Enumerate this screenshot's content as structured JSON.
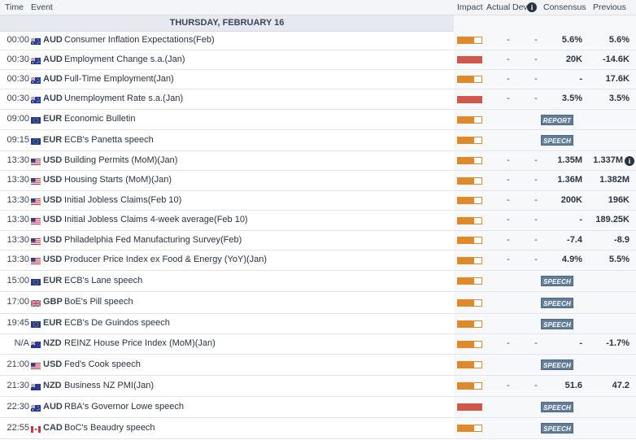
{
  "header": {
    "time": "Time",
    "event": "Event",
    "impact": "Impact",
    "actual": "Actual",
    "dev": "Dev",
    "consensus": "Consensus",
    "previous": "Previous"
  },
  "date_label": "THURSDAY, FEBRUARY 16",
  "colors": {
    "impact_medium": "#e0892a",
    "impact_high": "#d0574a",
    "tag_bg": "#627d98"
  },
  "rows": [
    {
      "time": "00:00",
      "flag": "au",
      "currency": "AUD",
      "event": "Consumer Inflation Expectations(Feb)",
      "impact": "medium",
      "actual": "-",
      "dev": "-",
      "consensus": "5.6%",
      "previous": "5.6%"
    },
    {
      "time": "00:30",
      "flag": "au",
      "currency": "AUD",
      "event": "Employment Change s.a.(Jan)",
      "impact": "high",
      "actual": "-",
      "dev": "-",
      "consensus": "20K",
      "previous": "-14.6K"
    },
    {
      "time": "00:30",
      "flag": "au",
      "currency": "AUD",
      "event": "Full-Time Employment(Jan)",
      "impact": "medium",
      "actual": "-",
      "dev": "-",
      "consensus": "-",
      "previous": "17.6K"
    },
    {
      "time": "00:30",
      "flag": "au",
      "currency": "AUD",
      "event": "Unemployment Rate s.a.(Jan)",
      "impact": "high",
      "actual": "-",
      "dev": "-",
      "consensus": "3.5%",
      "previous": "3.5%"
    },
    {
      "time": "09:00",
      "flag": "eu",
      "currency": "EUR",
      "event": "Economic Bulletin",
      "impact": "medium",
      "tag": "REPORT"
    },
    {
      "time": "09:15",
      "flag": "eu",
      "currency": "EUR",
      "event": "ECB's Panetta speech",
      "impact": "medium",
      "tag": "SPEECH"
    },
    {
      "time": "13:30",
      "flag": "us",
      "currency": "USD",
      "event": "Building Permits (MoM)(Jan)",
      "impact": "medium",
      "actual": "-",
      "dev": "-",
      "consensus": "1.35M",
      "previous": "1.337M",
      "prev_info": "i"
    },
    {
      "time": "13:30",
      "flag": "us",
      "currency": "USD",
      "event": "Housing Starts (MoM)(Jan)",
      "impact": "medium",
      "actual": "-",
      "dev": "-",
      "consensus": "1.36M",
      "previous": "1.382M"
    },
    {
      "time": "13:30",
      "flag": "us",
      "currency": "USD",
      "event": "Initial Jobless Claims(Feb 10)",
      "impact": "medium",
      "actual": "-",
      "dev": "-",
      "consensus": "200K",
      "previous": "196K"
    },
    {
      "time": "13:30",
      "flag": "us",
      "currency": "USD",
      "event": "Initial Jobless Claims 4-week average(Feb 10)",
      "impact": "medium",
      "actual": "-",
      "dev": "-",
      "consensus": "-",
      "previous": "189.25K"
    },
    {
      "time": "13:30",
      "flag": "us",
      "currency": "USD",
      "event": "Philadelphia Fed Manufacturing Survey(Feb)",
      "impact": "medium",
      "actual": "-",
      "dev": "-",
      "consensus": "-7.4",
      "previous": "-8.9"
    },
    {
      "time": "13:30",
      "flag": "us",
      "currency": "USD",
      "event": "Producer Price Index ex Food & Energy (YoY)(Jan)",
      "impact": "medium",
      "actual": "-",
      "dev": "-",
      "consensus": "4.9%",
      "previous": "5.5%"
    },
    {
      "time": "15:00",
      "flag": "eu",
      "currency": "EUR",
      "event": "ECB's Lane speech",
      "impact": "medium",
      "tag": "SPEECH"
    },
    {
      "time": "17:00",
      "flag": "gb",
      "currency": "GBP",
      "event": "BoE's Pill speech",
      "impact": "medium",
      "tag": "SPEECH"
    },
    {
      "time": "19:45",
      "flag": "eu",
      "currency": "EUR",
      "event": "ECB's De Guindos speech",
      "impact": "medium",
      "tag": "SPEECH"
    },
    {
      "time": "N/A",
      "flag": "nz",
      "currency": "NZD",
      "event": "REINZ House Price Index (MoM)(Jan)",
      "impact": "medium",
      "actual": "-",
      "dev": "-",
      "consensus": "-",
      "previous": "-1.7%"
    },
    {
      "time": "21:00",
      "flag": "us",
      "currency": "USD",
      "event": "Fed's Cook speech",
      "impact": "medium",
      "tag": "SPEECH"
    },
    {
      "time": "21:30",
      "flag": "nz",
      "currency": "NZD",
      "event": "Business NZ PMI(Jan)",
      "impact": "medium",
      "actual": "-",
      "dev": "-",
      "consensus": "51.6",
      "previous": "47.2"
    },
    {
      "time": "22:30",
      "flag": "au",
      "currency": "AUD",
      "event": "RBA's Governor Lowe speech",
      "impact": "high",
      "tag": "SPEECH"
    },
    {
      "time": "22:55",
      "flag": "ca",
      "currency": "CAD",
      "event": "BoC's Beaudry speech",
      "impact": "medium",
      "tag": "SPEECH"
    }
  ]
}
